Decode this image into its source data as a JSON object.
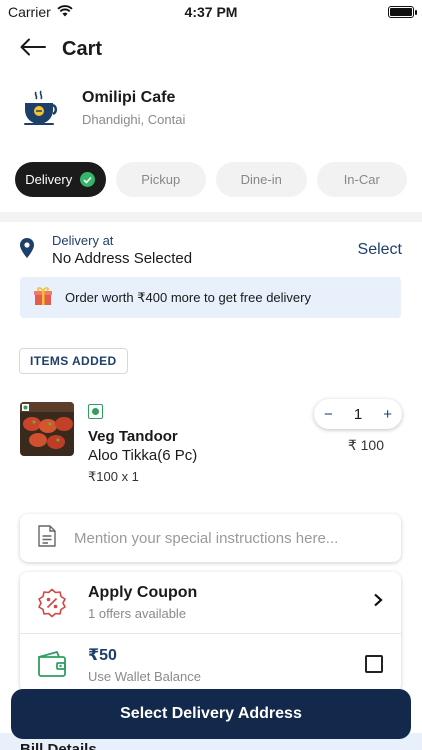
{
  "status_bar": {
    "carrier": "Carrier",
    "time": "4:37 PM"
  },
  "header": {
    "title": "Cart"
  },
  "cafe": {
    "name": "Omilipi Cafe",
    "location": "Dhandighi, Contai"
  },
  "tabs": [
    {
      "label": "Delivery",
      "active": true
    },
    {
      "label": "Pickup",
      "active": false
    },
    {
      "label": "Dine-in",
      "active": false
    },
    {
      "label": "In-Car",
      "active": false
    }
  ],
  "delivery": {
    "label": "Delivery at",
    "address": "No Address Selected",
    "action": "Select"
  },
  "promo": {
    "text": "Order worth ₹400 more to get free delivery"
  },
  "items_section": {
    "title": "ITEMS ADDED"
  },
  "items": [
    {
      "name": "Veg Tandoor",
      "subtitle": "Aloo Tikka(6 Pc)",
      "price_qty": "₹100 x 1",
      "quantity": "1",
      "total": "₹ 100",
      "minus": "−",
      "plus": "+"
    }
  ],
  "instructions": {
    "placeholder": "Mention your special instructions here..."
  },
  "coupon": {
    "title": "Apply Coupon",
    "subtitle": "1 offers available"
  },
  "wallet": {
    "amount": "₹50",
    "subtitle": "Use Wallet Balance",
    "checked": false
  },
  "bill": {
    "title": "Bill Details"
  },
  "cta": {
    "label": "Select Delivery Address"
  },
  "colors": {
    "primary": "#13294b",
    "accent_text": "#1f3f6b",
    "veg_green": "#2f9e5e",
    "promo_bg": "#e7f0fb",
    "coupon_red": "#d64545",
    "wallet_green": "#2f9e5e"
  }
}
